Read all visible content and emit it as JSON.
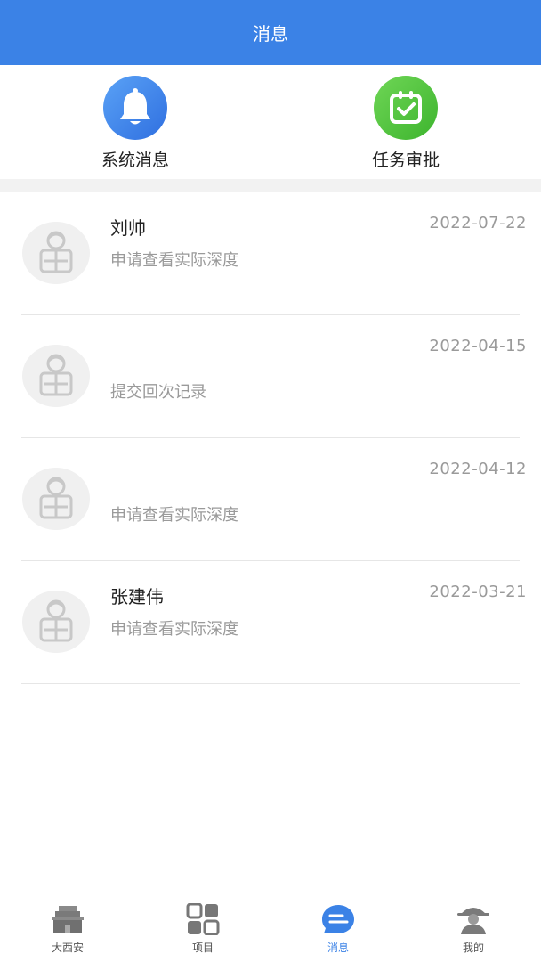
{
  "header": {
    "title": "消息"
  },
  "quick": {
    "system": {
      "label": "系统消息"
    },
    "task": {
      "label": "任务审批"
    }
  },
  "messages": [
    {
      "name": "刘帅",
      "date": "2022-07-22",
      "content": "申请查看实际深度"
    },
    {
      "name": "",
      "date": "2022-04-15",
      "content": "提交回次记录"
    },
    {
      "name": "",
      "date": "2022-04-12",
      "content": "申请查看实际深度"
    },
    {
      "name": "张建伟",
      "date": "2022-03-21",
      "content": "申请查看实际深度"
    }
  ],
  "tabs": [
    {
      "label": "大西安",
      "icon": "building-icon"
    },
    {
      "label": "项目",
      "icon": "grid-icon"
    },
    {
      "label": "消息",
      "icon": "message-icon",
      "active": true
    },
    {
      "label": "我的",
      "icon": "user-icon"
    }
  ],
  "colors": {
    "primary": "#3b82e6",
    "green": "#4cc23a",
    "muted": "#9a9a9a"
  }
}
